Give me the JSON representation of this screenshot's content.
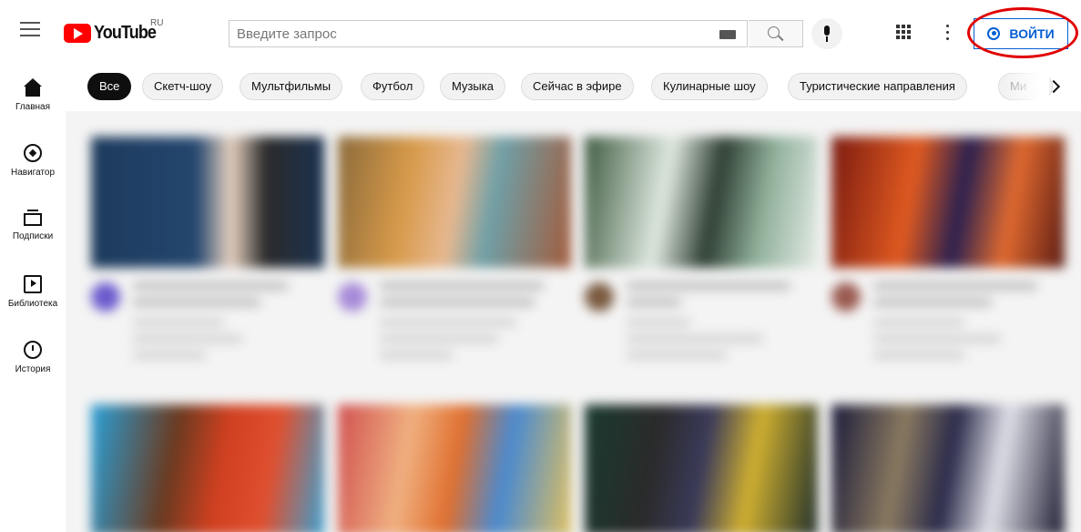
{
  "header": {
    "logo_text": "YouTube",
    "region": "RU",
    "search_placeholder": "Введите запрос",
    "signin_label": "ВОЙТИ"
  },
  "sidebar": {
    "items": [
      {
        "label": "Главная",
        "icon": "home-icon"
      },
      {
        "label": "Навигатор",
        "icon": "compass-icon"
      },
      {
        "label": "Подписки",
        "icon": "subscriptions-icon"
      },
      {
        "label": "Библиотека",
        "icon": "library-icon"
      },
      {
        "label": "История",
        "icon": "history-icon"
      }
    ]
  },
  "chips": [
    {
      "label": "Все",
      "active": true
    },
    {
      "label": "Скетч-шоу"
    },
    {
      "label": "Мультфильмы"
    },
    {
      "label": "Футбол"
    },
    {
      "label": "Музыка"
    },
    {
      "label": "Сейчас в эфире"
    },
    {
      "label": "Кулинарные шоу"
    },
    {
      "label": "Туристические направления"
    },
    {
      "label": "Ми"
    }
  ],
  "colors": {
    "brand_red": "#ff0000",
    "link_blue": "#065fd4",
    "annotation_red": "#e00000"
  }
}
